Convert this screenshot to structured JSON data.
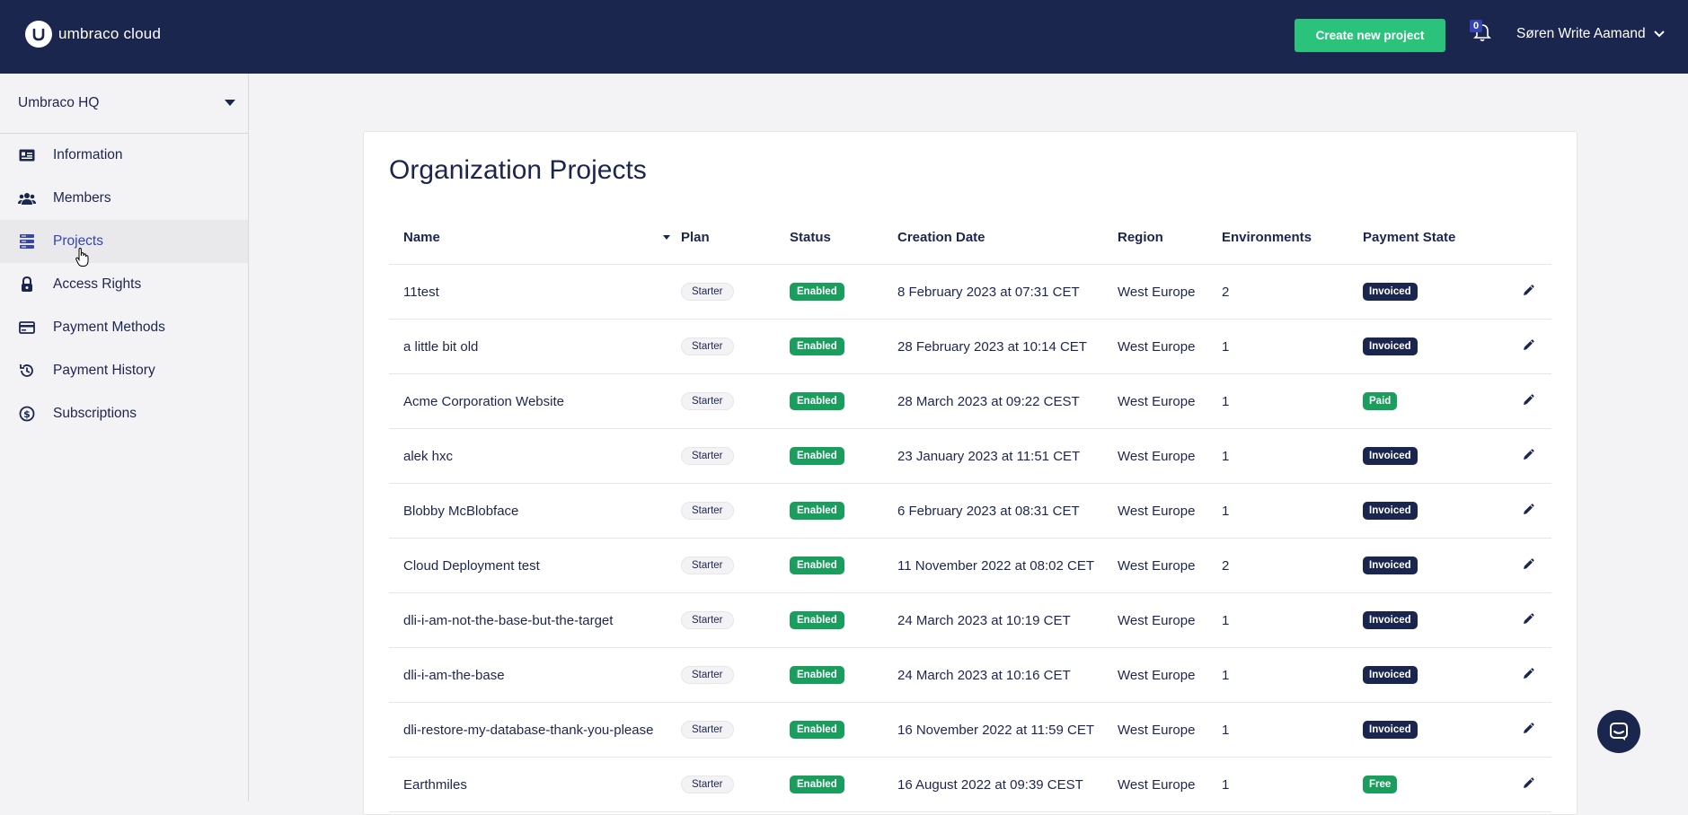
{
  "brand": {
    "logo_text": "umbraco cloud"
  },
  "header": {
    "create_button": "Create new project",
    "notification_count": "0",
    "user_name": "Søren Write Aamand"
  },
  "sidebar": {
    "org_name": "Umbraco HQ",
    "items": [
      {
        "label": "Information",
        "icon": "id-card-icon",
        "active": false
      },
      {
        "label": "Members",
        "icon": "users-icon",
        "active": false
      },
      {
        "label": "Projects",
        "icon": "server-stack-icon",
        "active": true
      },
      {
        "label": "Access Rights",
        "icon": "lock-icon",
        "active": false
      },
      {
        "label": "Payment Methods",
        "icon": "credit-card-icon",
        "active": false
      },
      {
        "label": "Payment History",
        "icon": "history-icon",
        "active": false
      },
      {
        "label": "Subscriptions",
        "icon": "dollar-circle-icon",
        "active": false
      }
    ]
  },
  "main": {
    "title": "Organization Projects",
    "columns": {
      "name": "Name",
      "plan": "Plan",
      "status": "Status",
      "creation_date": "Creation Date",
      "region": "Region",
      "environments": "Environments",
      "payment_state": "Payment State"
    },
    "rows": [
      {
        "name": "11test",
        "plan": "Starter",
        "status": "Enabled",
        "date": "8 February 2023 at 07:31 CET",
        "region": "West Europe",
        "env": "2",
        "payment": "Invoiced",
        "payment_type": "invoiced"
      },
      {
        "name": "a little bit old",
        "plan": "Starter",
        "status": "Enabled",
        "date": "28 February 2023 at 10:14 CET",
        "region": "West Europe",
        "env": "1",
        "payment": "Invoiced",
        "payment_type": "invoiced"
      },
      {
        "name": "Acme Corporation Website",
        "plan": "Starter",
        "status": "Enabled",
        "date": "28 March 2023 at 09:22 CEST",
        "region": "West Europe",
        "env": "1",
        "payment": "Paid",
        "payment_type": "paid"
      },
      {
        "name": "alek hxc",
        "plan": "Starter",
        "status": "Enabled",
        "date": "23 January 2023 at 11:51 CET",
        "region": "West Europe",
        "env": "1",
        "payment": "Invoiced",
        "payment_type": "invoiced"
      },
      {
        "name": "Blobby McBlobface",
        "plan": "Starter",
        "status": "Enabled",
        "date": "6 February 2023 at 08:31 CET",
        "region": "West Europe",
        "env": "1",
        "payment": "Invoiced",
        "payment_type": "invoiced"
      },
      {
        "name": "Cloud Deployment test",
        "plan": "Starter",
        "status": "Enabled",
        "date": "11 November 2022 at 08:02 CET",
        "region": "West Europe",
        "env": "2",
        "payment": "Invoiced",
        "payment_type": "invoiced"
      },
      {
        "name": "dli-i-am-not-the-base-but-the-target",
        "plan": "Starter",
        "status": "Enabled",
        "date": "24 March 2023 at 10:19 CET",
        "region": "West Europe",
        "env": "1",
        "payment": "Invoiced",
        "payment_type": "invoiced"
      },
      {
        "name": "dli-i-am-the-base",
        "plan": "Starter",
        "status": "Enabled",
        "date": "24 March 2023 at 10:16 CET",
        "region": "West Europe",
        "env": "1",
        "payment": "Invoiced",
        "payment_type": "invoiced"
      },
      {
        "name": "dli-restore-my-database-thank-you-please",
        "plan": "Starter",
        "status": "Enabled",
        "date": "16 November 2022 at 11:59 CET",
        "region": "West Europe",
        "env": "1",
        "payment": "Invoiced",
        "payment_type": "invoiced"
      },
      {
        "name": "Earthmiles",
        "plan": "Starter",
        "status": "Enabled",
        "date": "16 August 2022 at 09:39 CEST",
        "region": "West Europe",
        "env": "1",
        "payment": "Free",
        "payment_type": "free"
      }
    ]
  },
  "colors": {
    "navy": "#1b264f",
    "accent_green": "#2bc37c",
    "status_green": "#1a9e5e",
    "active_blue": "#3544b1"
  }
}
